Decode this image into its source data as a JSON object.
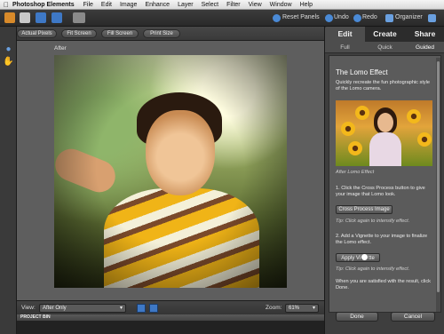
{
  "menubar": {
    "apple_icon": "apple-logo",
    "app_name": "Photoshop Elements",
    "items": [
      "File",
      "Edit",
      "Image",
      "Enhance",
      "Layer",
      "Select",
      "Filter",
      "View",
      "Window",
      "Help"
    ]
  },
  "toolbar": {
    "reset_panels": "Reset Panels",
    "undo": "Undo",
    "redo": "Redo",
    "organizer": "Organizer"
  },
  "options": {
    "actual_pixels": "Actual Pixels",
    "fit_screen": "Fit Screen",
    "fill_screen": "Fill Screen",
    "print_size": "Print Size"
  },
  "document": {
    "label": "After"
  },
  "status": {
    "view_label": "View:",
    "view_value": "After Only",
    "zoom_label": "Zoom:",
    "zoom_value": "61%"
  },
  "project_bin": {
    "label": "PROJECT BIN"
  },
  "panel": {
    "tabs": [
      "Edit",
      "Create",
      "Share"
    ],
    "subtabs": [
      "Full",
      "Quick",
      "Guided"
    ],
    "title": "The Lomo Effect",
    "intro": "Quickly recreate the fun photographic style of the Lomo camera.",
    "caption": "After Lomo Effect",
    "step1": "1. Click the Cross Process button to give your image that Lomo look.",
    "step1_button": "Cross Process Image",
    "step1_tip": "Tip: Click again to intensify effect.",
    "step2": "2. Add a Vignette to your image to finalize the Lomo effect.",
    "step2_button": "Apply Vi",
    "step2_button_end": "tte",
    "step2_tip": "Tip: Click again to intensify effect.",
    "closing": "When you are satisfied with the result, click Done.",
    "done": "Done",
    "cancel": "Cancel"
  },
  "colors": {
    "panel_bg": "#5b5b5b",
    "accent_blue": "#3e78c5"
  }
}
